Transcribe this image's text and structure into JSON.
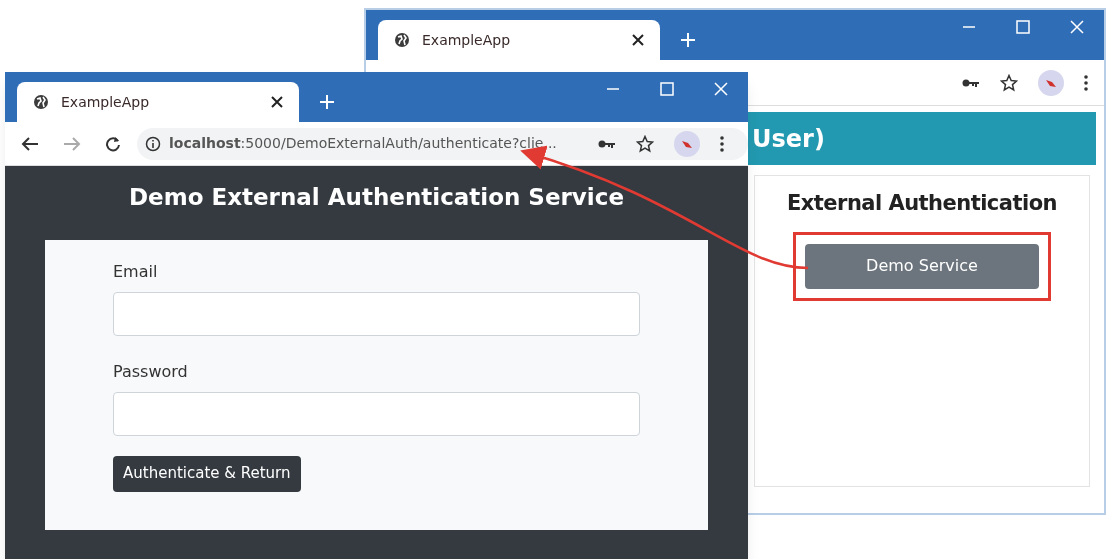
{
  "back_window": {
    "tab_title": "ExampleApp",
    "banner_text": "User)",
    "card_title": "External Authentication",
    "button": "Demo Service",
    "button_highlighted": true
  },
  "front_window": {
    "tab_title": "ExampleApp",
    "url": "**localhost**:5000/DemoExternalAuth/authenticate?clie...",
    "heading": "Demo External Authentication Service",
    "fields": [
      {
        "label": "Email"
      },
      {
        "label": "Password"
      }
    ],
    "button": "Authenticate & Return"
  }
}
